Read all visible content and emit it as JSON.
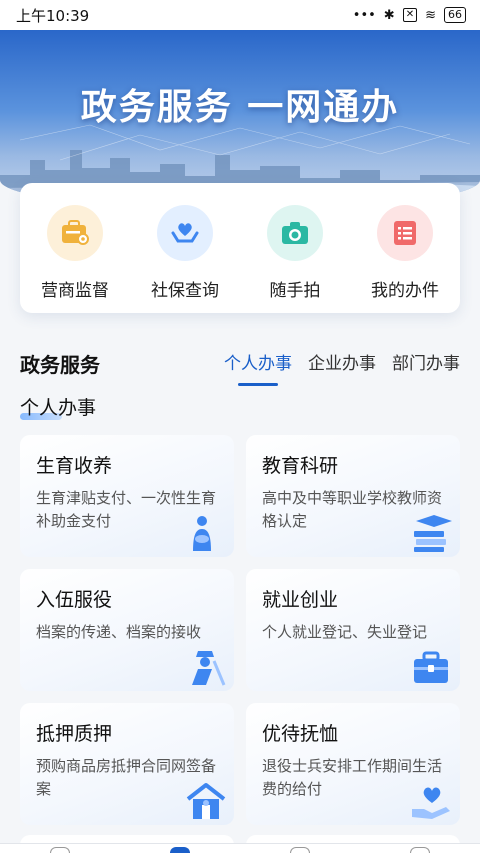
{
  "status_bar": {
    "time": "上午10:39",
    "dots": "•••",
    "bluetooth": "✱",
    "box": "✕",
    "wifi": "≋",
    "battery": "66"
  },
  "banner": {
    "title": "政务服务 一网通办"
  },
  "quick_actions": [
    {
      "label": "营商监督",
      "icon": "briefcase-eye-icon",
      "bg": "#fdf0d9",
      "color": "#f0b23c"
    },
    {
      "label": "社保查询",
      "icon": "heart-hands-icon",
      "bg": "#e3efff",
      "color": "#3e86f0"
    },
    {
      "label": "随手拍",
      "icon": "camera-icon",
      "bg": "#def5f1",
      "color": "#2bb8a3"
    },
    {
      "label": "我的办件",
      "icon": "list-doc-icon",
      "bg": "#fde4e4",
      "color": "#f06a6a"
    }
  ],
  "section": {
    "title": "政务服务",
    "tabs": [
      "个人办事",
      "企业办事",
      "部门办事"
    ],
    "active_tab": "个人办事",
    "sub_title": "个人办事"
  },
  "services": [
    {
      "title": "生育收养",
      "desc": "生育津贴支付、一次性生育补助金支付",
      "icon": "mother-baby-icon"
    },
    {
      "title": "教育科研",
      "desc": "高中及中等职业学校教师资格认定",
      "icon": "books-cap-icon"
    },
    {
      "title": "入伍服役",
      "desc": "档案的传递、档案的接收",
      "icon": "soldier-icon"
    },
    {
      "title": "就业创业",
      "desc": "个人就业登记、失业登记",
      "icon": "briefcase-icon"
    },
    {
      "title": "抵押质押",
      "desc": "预购商品房抵押合同网签备案",
      "icon": "house-icon"
    },
    {
      "title": "优待抚恤",
      "desc": "退役士兵安排工作期间生活费的给付",
      "icon": "heart-hand-icon"
    }
  ],
  "colors": {
    "accent": "#1a5fc9",
    "icon_blue": "#3e86f0"
  }
}
